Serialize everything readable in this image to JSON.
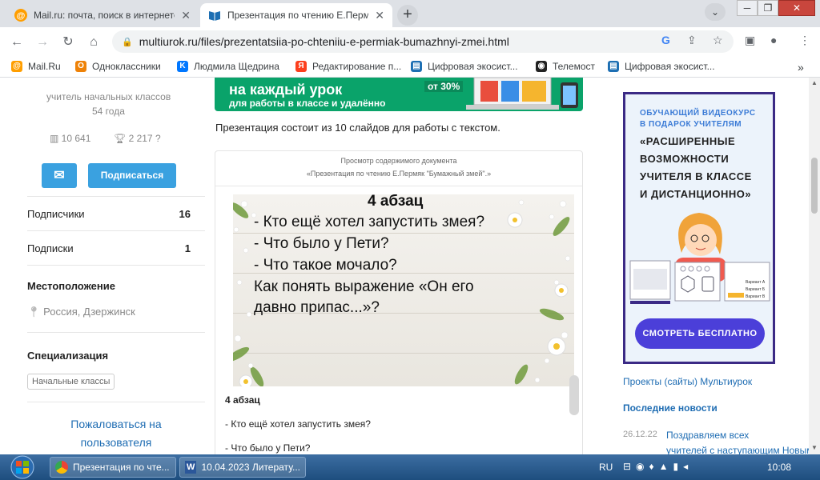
{
  "browser": {
    "tabs": [
      {
        "title": "Mail.ru: почта, поиск в интернете"
      },
      {
        "title": "Презентация по чтению Е.Перм"
      }
    ],
    "url": "multiurok.ru/files/prezentatsiia-po-chteniiu-e-permiak-bumazhnyi-zmei.html",
    "bookmarks": [
      "Mail.Ru",
      "Одноклассники",
      "Людмила Щедрина",
      "Редактирование п...",
      "Цифровая экосист...",
      "Телемост",
      "Цифровая экосист..."
    ]
  },
  "profile": {
    "role": "учитель начальных классов",
    "age": "54 года",
    "views": "10 641",
    "awards": "2 217",
    "subscribe_label": "Подписаться",
    "subscribers_label": "Подписчики",
    "subscribers_value": "16",
    "subscriptions_label": "Подписки",
    "subscriptions_value": "1",
    "location_heading": "Местоположение",
    "location_value": "Россия, Дзержинск",
    "specialization_heading": "Специализация",
    "specialization_tag": "Начальные классы",
    "report_line1": "Пожаловаться на",
    "report_line2": "пользователя"
  },
  "main": {
    "banner_line1": "на каждый урок",
    "banner_line2": "для работы в классе и удалённо",
    "banner_discount": "от 30%",
    "intro": "Презентация состоит из 10 слайдов для работы с текстом.",
    "viewer_heading": "Просмотр содержимого документа",
    "viewer_subheading": "«Презентация по чтению Е.Пермяк \"Бумажный змей\".»",
    "slide": {
      "title": "4 абзац",
      "line1": "- Кто ещё хотел запустить змея?",
      "line2": "- Что было у Пети?",
      "line3": "- Что такое мочало?",
      "line4": "Как понять выражение «Он его",
      "line5": "давно припас...»?"
    },
    "text_title": "4 абзац",
    "text_line1": "- Кто ещё хотел запустить змея?",
    "text_line2": "- Что было у Пети?"
  },
  "sidebar": {
    "ad_line1": "ОБУЧАЮЩИЙ ВИДЕОКУРС",
    "ad_line2": "В ПОДАРОК УЧИТЕЛЯМ",
    "ad_line3": "«РАСШИРЕННЫЕ",
    "ad_line4": "ВОЗМОЖНОСТИ",
    "ad_line5": "УЧИТЕЛЯ В КЛАССЕ",
    "ad_line6": "И ДИСТАНЦИОННО»",
    "ad_option1": "Вариант А",
    "ad_option2": "Вариант Б",
    "ad_option3": "Вариант В",
    "ad_button": "СМОТРЕТЬ БЕСПЛАТНО",
    "projects_link": "Проекты (сайты) Мультиурок",
    "news_heading": "Последние новости",
    "news_date": "26.12.22",
    "news_line1": "Поздравляем всех",
    "news_line2": "учителей с наступающим Новым"
  },
  "taskbar": {
    "items": [
      "Презентация по чте...",
      "10.04.2023 Литерату..."
    ],
    "lang": "RU",
    "clock": "10:08"
  },
  "colors": {
    "accent": "#3aa1e0",
    "banner": "#0aa36a",
    "ad_border": "#3b2a85",
    "ad_button": "#4b3fd9",
    "link": "#1f6db3"
  }
}
